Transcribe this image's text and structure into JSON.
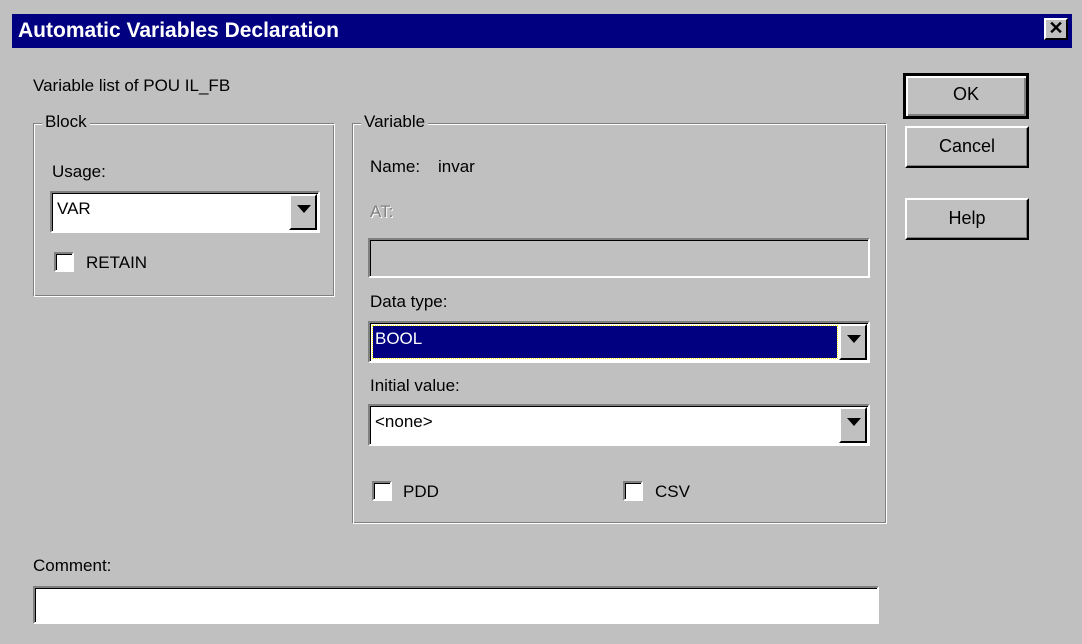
{
  "window": {
    "title": "Automatic Variables Declaration",
    "close_glyph": "✕"
  },
  "pou_label": "Variable list of POU IL_FB",
  "block": {
    "legend": "Block",
    "usage_label": "Usage:",
    "usage_value": "VAR",
    "retain_label": "RETAIN",
    "retain_checked": false
  },
  "variable": {
    "legend": "Variable",
    "name_label": "Name:",
    "name_value": "invar",
    "at_label": "AT:",
    "at_value": "",
    "data_type_label": "Data type:",
    "data_type_value": "BOOL",
    "initial_value_label": "Initial value:",
    "initial_value_value": "<none>",
    "pdd_label": "PDD",
    "pdd_checked": false,
    "csv_label": "CSV",
    "csv_checked": false
  },
  "comment": {
    "label": "Comment:",
    "value": ""
  },
  "buttons": {
    "ok": "OK",
    "cancel": "Cancel",
    "help": "Help"
  }
}
